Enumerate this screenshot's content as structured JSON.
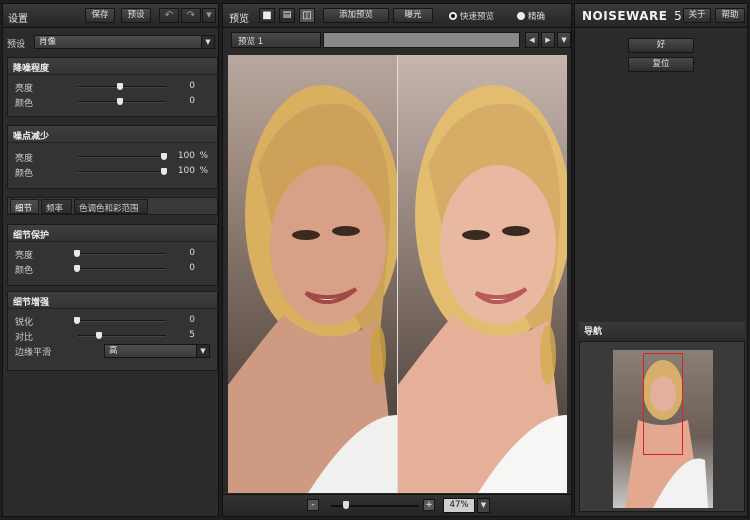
{
  "left": {
    "title": "设置",
    "save_label": "保存",
    "preset_button": "预设",
    "undo_icon": "undo-icon",
    "redo_icon": "redo-icon",
    "preset_label": "预设",
    "preset_value": "肖像",
    "noise_level": {
      "title": "降噪程度",
      "rows": [
        {
          "label": "亮度",
          "value": "0",
          "level": 0.5
        },
        {
          "label": "颜色",
          "value": "0",
          "level": 0.5
        }
      ]
    },
    "noise_reduction": {
      "title": "噪点减少",
      "rows": [
        {
          "label": "亮度",
          "value": "100",
          "unit": "%",
          "level": 1.0
        },
        {
          "label": "颜色",
          "value": "100",
          "unit": "%",
          "level": 1.0
        }
      ]
    },
    "tabs": [
      "细节",
      "频率",
      "色调色和彩范围"
    ],
    "detail_protection": {
      "title": "细节保护",
      "rows": [
        {
          "label": "亮度",
          "value": "0",
          "level": 0.0
        },
        {
          "label": "颜色",
          "value": "0",
          "level": 0.0
        }
      ]
    },
    "detail_enhance": {
      "title": "细节增强",
      "rows": [
        {
          "label": "锐化",
          "value": "0",
          "level": 0.0
        },
        {
          "label": "对比",
          "value": "5",
          "level": 0.25
        }
      ],
      "edge_label": "边缘平滑",
      "edge_value": "高"
    }
  },
  "center": {
    "title": "预览",
    "add_preview": "添加预览",
    "exposure": "曝光",
    "fast_preview": "快速预览",
    "precise": "精确",
    "preview_tab": "预览 1",
    "zoom_minus": "-",
    "zoom_plus": "+",
    "zoom_value": "47%",
    "zoom_level": 0.2
  },
  "right": {
    "logo_main": "NOISEWARE",
    "logo_ver": "5",
    "about": "关于",
    "help": "帮助",
    "ok": "好",
    "reset": "复位",
    "navigator": "导航"
  },
  "colors": {
    "panel": "#2b2b2b",
    "accent_red": "#e02020"
  }
}
